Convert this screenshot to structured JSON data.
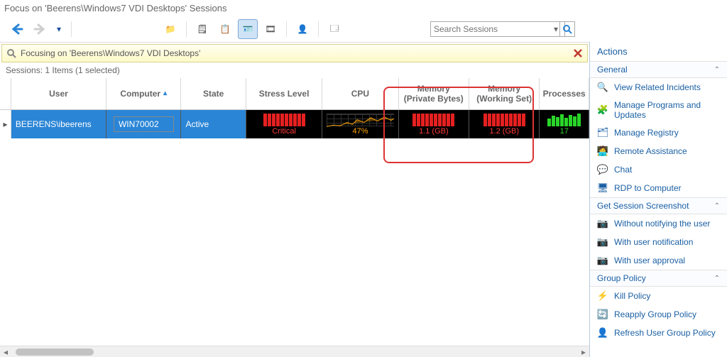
{
  "window_title": "Focus on 'Beerens\\Windows7 VDI Desktops' Sessions",
  "search": {
    "placeholder": "Search Sessions"
  },
  "focus_message": "Focusing on 'Beerens\\Windows7 VDI Desktops'",
  "sessions_info": "Sessions: 1 Items (1 selected)",
  "columns": {
    "user": "User",
    "computer": "Computer",
    "state": "State",
    "stress": "Stress Level",
    "cpu": "CPU",
    "mem_priv": "Memory\n(Private Bytes)",
    "mem_ws": "Memory\n(Working Set)",
    "proc": "Processes"
  },
  "row": {
    "user": "BEERENS\\ibeerens",
    "computer": "WIN70002",
    "state": "Active",
    "stress": "Critical",
    "cpu": "47%",
    "mem_priv": "1.1 (GB)",
    "mem_ws": "1.2 (GB)",
    "proc": "17"
  },
  "actions": {
    "title": "Actions",
    "groups": [
      {
        "label": "General",
        "items": [
          {
            "icon": "🔍",
            "label": "View Related Incidents"
          },
          {
            "icon": "🧩",
            "label": "Manage Programs and Updates"
          },
          {
            "icon": "🗂",
            "label": "Manage Registry"
          },
          {
            "icon": "🧑‍💻",
            "label": "Remote Assistance"
          },
          {
            "icon": "💬",
            "label": "Chat"
          },
          {
            "icon": "🖥",
            "label": "RDP to Computer"
          }
        ]
      },
      {
        "label": "Get Session Screenshot",
        "items": [
          {
            "icon": "📷",
            "label": "Without notifying the user"
          },
          {
            "icon": "📷",
            "label": "With user notification"
          },
          {
            "icon": "📷",
            "label": "With user approval"
          }
        ]
      },
      {
        "label": "Group Policy",
        "items": [
          {
            "icon": "⚡",
            "label": "Kill Policy"
          },
          {
            "icon": "🔄",
            "label": "Reapply Group Policy"
          },
          {
            "icon": "👤",
            "label": "Refresh User Group Policy"
          }
        ]
      }
    ]
  }
}
